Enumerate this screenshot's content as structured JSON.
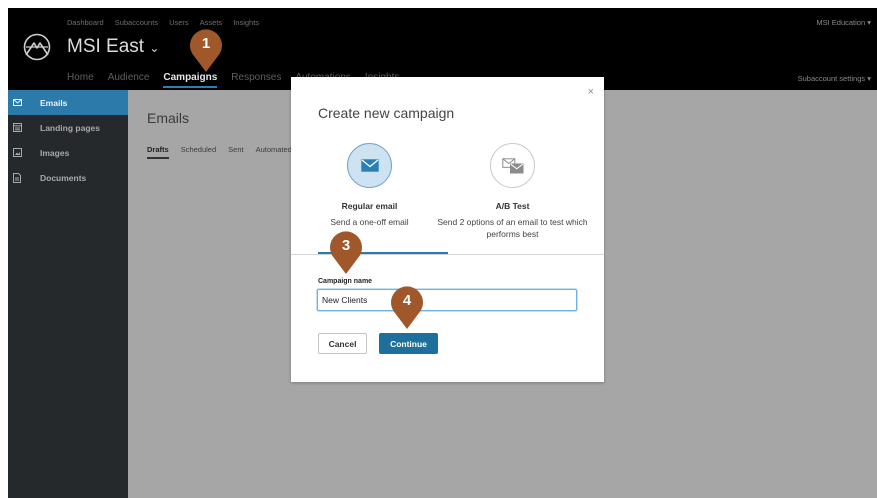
{
  "top_nav": [
    "Dashboard",
    "Subaccounts",
    "Users",
    "Assets",
    "Insights"
  ],
  "account_name": "MSI Education",
  "subaccount": {
    "name": "MSI East",
    "caret": "⌄"
  },
  "sub_nav": [
    "Home",
    "Audience",
    "Campaigns",
    "Responses",
    "Automations",
    "Insights"
  ],
  "sub_nav_active": "Campaigns",
  "subaccount_settings": "Subaccount settings",
  "sidebar": {
    "items": [
      {
        "label": "Emails",
        "icon": "envelope-icon"
      },
      {
        "label": "Landing pages",
        "icon": "page-icon"
      },
      {
        "label": "Images",
        "icon": "image-icon"
      },
      {
        "label": "Documents",
        "icon": "document-icon"
      }
    ],
    "active": "Emails"
  },
  "main": {
    "title": "Emails",
    "tabs": [
      "Drafts",
      "Scheduled",
      "Sent",
      "Automated"
    ],
    "active_tab": "Drafts"
  },
  "modal": {
    "title": "Create new campaign",
    "close": "×",
    "options": [
      {
        "label": "Regular email",
        "description": "Send a one-off email",
        "icon": "envelope-icon",
        "selected": true
      },
      {
        "label": "A/B Test",
        "description": "Send 2 options of an email to test which performs best",
        "icon": "two-envelopes-icon",
        "selected": false
      }
    ],
    "field_label": "Campaign name",
    "field_value": "New Clients",
    "cancel": "Cancel",
    "continue": "Continue"
  },
  "markers": [
    "1",
    "3",
    "4"
  ],
  "colors": {
    "accent": "#2c7aaa",
    "marker": "#a0582b",
    "button": "#1f6f9c"
  }
}
